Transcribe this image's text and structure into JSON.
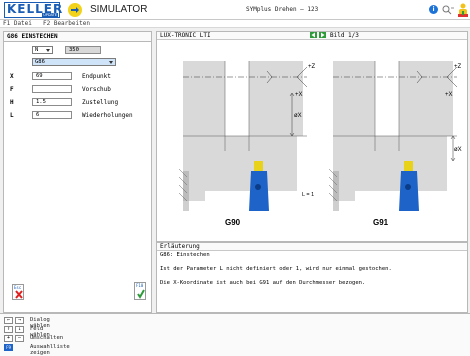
{
  "app": {
    "logo_text": "KELLER",
    "logo_badge": "UPDATE",
    "name": "SIMULATOR",
    "window_title": "SYMplus Drehen – 123",
    "info_icon_char": "i"
  },
  "menu": {
    "f1": "F1 Datei",
    "f2": "F2 Bearbeiten"
  },
  "cycle_panel": {
    "title": "G86 EINSTECHEN",
    "mode": "N",
    "block_number": "350",
    "gcode_option": "G86",
    "params": [
      {
        "label": "X",
        "value": "69",
        "description": "Endpunkt"
      },
      {
        "label": "F",
        "value": "",
        "description": "Vorschub"
      },
      {
        "label": "H",
        "value": "1.5",
        "description": "Zustellung"
      },
      {
        "label": "L",
        "value": "6",
        "description": "Wiederholungen"
      }
    ],
    "esc_label": "Esc",
    "f10_label": "F10"
  },
  "graphic": {
    "control_name": "LUX-TRONIC LTI",
    "page_label": "Bild 1/3",
    "left_caption": "G90",
    "right_caption": "G91",
    "l_annotation": "L = 1",
    "axis_z": "+Z",
    "axis_x": "+X",
    "dim_left": "øX",
    "dim_right": "øX"
  },
  "explanation": {
    "title": "Erläuterung",
    "lines": [
      "G86: Einstechen",
      "Ist der Parameter L nicht definiert oder 1, wird nur einmal gestochen.",
      "Die X-Koordinate ist auch bei G91 auf den Durchmesser bezogen."
    ]
  },
  "footer": {
    "hints": [
      {
        "keys": [
          "←",
          "→"
        ],
        "text": "Dialog wählen"
      },
      {
        "keys": [
          "↑",
          "↓"
        ],
        "text": "Feld wählen"
      },
      {
        "keys": [
          "+",
          "–"
        ],
        "text": "Umschalten"
      },
      {
        "keys": [
          "F9"
        ],
        "text": "Auswahlliste zeigen"
      }
    ]
  },
  "colors": {
    "accent_blue": "#1a5db5",
    "nav_green": "#2e9b3a",
    "tool_yellow": "#e8d21a",
    "tool_blue": "#1e64c8",
    "dialog_highlight": "#cfe3f9"
  }
}
